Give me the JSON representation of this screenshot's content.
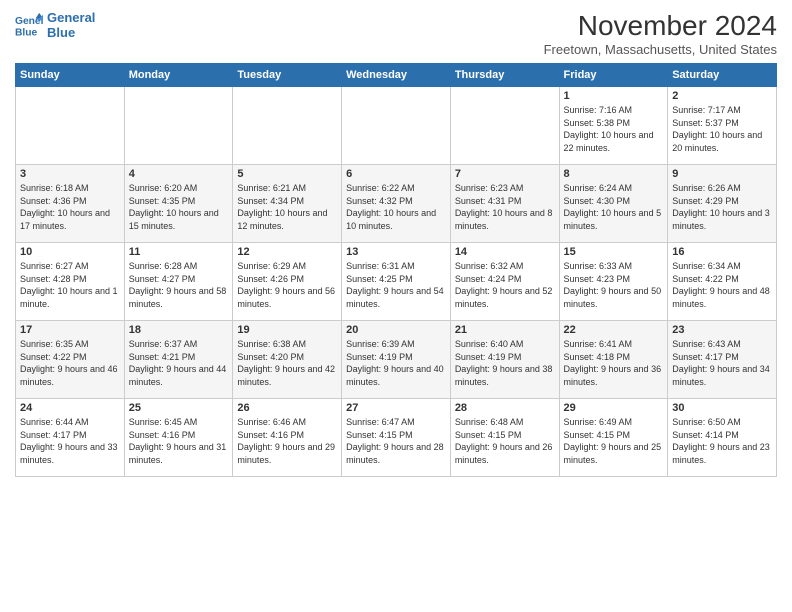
{
  "logo": {
    "line1": "General",
    "line2": "Blue"
  },
  "title": "November 2024",
  "subtitle": "Freetown, Massachusetts, United States",
  "days_of_week": [
    "Sunday",
    "Monday",
    "Tuesday",
    "Wednesday",
    "Thursday",
    "Friday",
    "Saturday"
  ],
  "weeks": [
    [
      {
        "day": "",
        "info": ""
      },
      {
        "day": "",
        "info": ""
      },
      {
        "day": "",
        "info": ""
      },
      {
        "day": "",
        "info": ""
      },
      {
        "day": "",
        "info": ""
      },
      {
        "day": "1",
        "info": "Sunrise: 7:16 AM\nSunset: 5:38 PM\nDaylight: 10 hours and 22 minutes."
      },
      {
        "day": "2",
        "info": "Sunrise: 7:17 AM\nSunset: 5:37 PM\nDaylight: 10 hours and 20 minutes."
      }
    ],
    [
      {
        "day": "3",
        "info": "Sunrise: 6:18 AM\nSunset: 4:36 PM\nDaylight: 10 hours and 17 minutes."
      },
      {
        "day": "4",
        "info": "Sunrise: 6:20 AM\nSunset: 4:35 PM\nDaylight: 10 hours and 15 minutes."
      },
      {
        "day": "5",
        "info": "Sunrise: 6:21 AM\nSunset: 4:34 PM\nDaylight: 10 hours and 12 minutes."
      },
      {
        "day": "6",
        "info": "Sunrise: 6:22 AM\nSunset: 4:32 PM\nDaylight: 10 hours and 10 minutes."
      },
      {
        "day": "7",
        "info": "Sunrise: 6:23 AM\nSunset: 4:31 PM\nDaylight: 10 hours and 8 minutes."
      },
      {
        "day": "8",
        "info": "Sunrise: 6:24 AM\nSunset: 4:30 PM\nDaylight: 10 hours and 5 minutes."
      },
      {
        "day": "9",
        "info": "Sunrise: 6:26 AM\nSunset: 4:29 PM\nDaylight: 10 hours and 3 minutes."
      }
    ],
    [
      {
        "day": "10",
        "info": "Sunrise: 6:27 AM\nSunset: 4:28 PM\nDaylight: 10 hours and 1 minute."
      },
      {
        "day": "11",
        "info": "Sunrise: 6:28 AM\nSunset: 4:27 PM\nDaylight: 9 hours and 58 minutes."
      },
      {
        "day": "12",
        "info": "Sunrise: 6:29 AM\nSunset: 4:26 PM\nDaylight: 9 hours and 56 minutes."
      },
      {
        "day": "13",
        "info": "Sunrise: 6:31 AM\nSunset: 4:25 PM\nDaylight: 9 hours and 54 minutes."
      },
      {
        "day": "14",
        "info": "Sunrise: 6:32 AM\nSunset: 4:24 PM\nDaylight: 9 hours and 52 minutes."
      },
      {
        "day": "15",
        "info": "Sunrise: 6:33 AM\nSunset: 4:23 PM\nDaylight: 9 hours and 50 minutes."
      },
      {
        "day": "16",
        "info": "Sunrise: 6:34 AM\nSunset: 4:22 PM\nDaylight: 9 hours and 48 minutes."
      }
    ],
    [
      {
        "day": "17",
        "info": "Sunrise: 6:35 AM\nSunset: 4:22 PM\nDaylight: 9 hours and 46 minutes."
      },
      {
        "day": "18",
        "info": "Sunrise: 6:37 AM\nSunset: 4:21 PM\nDaylight: 9 hours and 44 minutes."
      },
      {
        "day": "19",
        "info": "Sunrise: 6:38 AM\nSunset: 4:20 PM\nDaylight: 9 hours and 42 minutes."
      },
      {
        "day": "20",
        "info": "Sunrise: 6:39 AM\nSunset: 4:19 PM\nDaylight: 9 hours and 40 minutes."
      },
      {
        "day": "21",
        "info": "Sunrise: 6:40 AM\nSunset: 4:19 PM\nDaylight: 9 hours and 38 minutes."
      },
      {
        "day": "22",
        "info": "Sunrise: 6:41 AM\nSunset: 4:18 PM\nDaylight: 9 hours and 36 minutes."
      },
      {
        "day": "23",
        "info": "Sunrise: 6:43 AM\nSunset: 4:17 PM\nDaylight: 9 hours and 34 minutes."
      }
    ],
    [
      {
        "day": "24",
        "info": "Sunrise: 6:44 AM\nSunset: 4:17 PM\nDaylight: 9 hours and 33 minutes."
      },
      {
        "day": "25",
        "info": "Sunrise: 6:45 AM\nSunset: 4:16 PM\nDaylight: 9 hours and 31 minutes."
      },
      {
        "day": "26",
        "info": "Sunrise: 6:46 AM\nSunset: 4:16 PM\nDaylight: 9 hours and 29 minutes."
      },
      {
        "day": "27",
        "info": "Sunrise: 6:47 AM\nSunset: 4:15 PM\nDaylight: 9 hours and 28 minutes."
      },
      {
        "day": "28",
        "info": "Sunrise: 6:48 AM\nSunset: 4:15 PM\nDaylight: 9 hours and 26 minutes."
      },
      {
        "day": "29",
        "info": "Sunrise: 6:49 AM\nSunset: 4:15 PM\nDaylight: 9 hours and 25 minutes."
      },
      {
        "day": "30",
        "info": "Sunrise: 6:50 AM\nSunset: 4:14 PM\nDaylight: 9 hours and 23 minutes."
      }
    ]
  ]
}
